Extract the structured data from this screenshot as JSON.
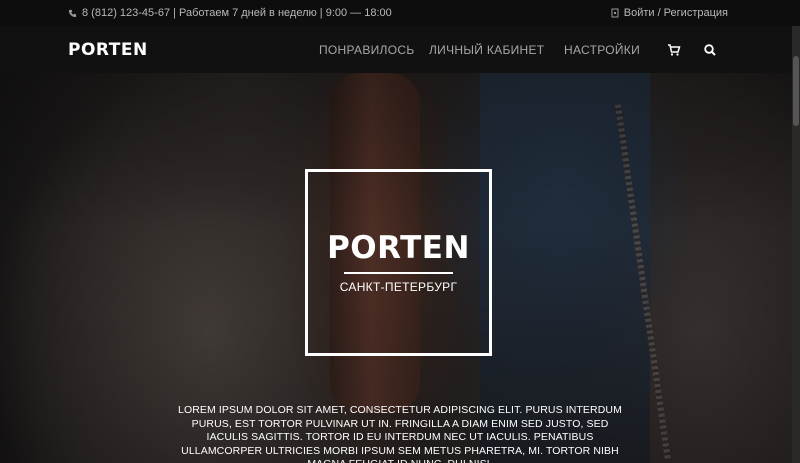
{
  "topbar": {
    "phone_icon": "phone-icon",
    "contact": "8 (812) 123-45-67 | Работаем 7 дней в неделю | 9:00 — 18:00",
    "login_icon": "login-icon",
    "login": "Войти / Регистрация"
  },
  "navbar": {
    "logo": "PORTEN",
    "items": [
      {
        "label": "ПОНРАВИЛОСЬ"
      },
      {
        "label": "ЛИЧНЫЙ КАБИНЕТ"
      },
      {
        "label": "НАСТРОЙКИ"
      }
    ],
    "cart_icon": "cart-icon",
    "search_icon": "search-icon"
  },
  "hero": {
    "logo": "PORTEN",
    "subtitle": "САНКТ-ПЕТЕРБУРГ",
    "text": "Lorem ipsum dolor sit amet, consectetur adipiscing elit. Purus interdum purus, est tortor pulvinar ut in. Fringilla a diam enim sed justo, sed iaculis sagittis. Tortor id eu interdum nec ut iaculis. Penatibus ullamcorper ultricies morbi ipsum sem metus pharetra, mi. Tortor nibh magna feugiat id nunc, dui nisl"
  },
  "colors": {
    "topbar_bg": "#0e0d0d",
    "navbar_bg": "#121111",
    "nav_text": "#a7a7a7",
    "accent": "#ffffff"
  }
}
